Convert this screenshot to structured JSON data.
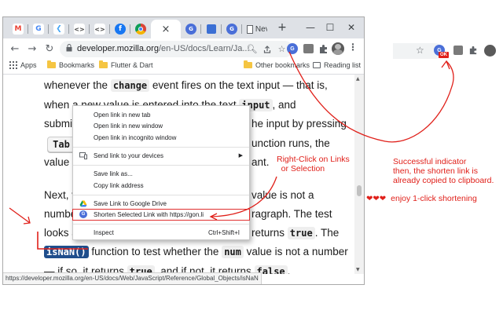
{
  "tabs": [
    {
      "icon": "gmail-icon",
      "letter": "M",
      "color": "#ea4335"
    },
    {
      "icon": "google-icon",
      "letter": "G",
      "color": "#4285f4"
    },
    {
      "icon": "flutter-icon",
      "letter": "❮",
      "color": "#42a5f5"
    },
    {
      "icon": "code-icon",
      "letter": "<>",
      "color": "#555555"
    },
    {
      "icon": "code-icon-2",
      "letter": "<>",
      "color": "#555555"
    },
    {
      "icon": "facebook-icon",
      "letter": "f",
      "color": "#1877f2"
    },
    {
      "icon": "chrome-icon",
      "letter": "",
      "color": "#db4437"
    }
  ],
  "active_tab": {
    "close": "×",
    "title": "Nev"
  },
  "new_tab": "+",
  "window_controls": {
    "minimize": "—",
    "maximize": "☐",
    "close": "✕"
  },
  "toolbar": {
    "back": "←",
    "forward": "→",
    "reload": "↻",
    "url_host": "developer.mozilla.org",
    "url_path": "/en-US/docs/Learn/Ja..."
  },
  "bookmarks": [
    {
      "label": "Apps",
      "kind": "apps"
    },
    {
      "label": "Bookmarks",
      "kind": "folder"
    },
    {
      "label": "Flutter & Dart",
      "kind": "folder"
    },
    {
      "label": "Other bookmarks",
      "kind": "folder"
    },
    {
      "label": "Reading list",
      "kind": "reading"
    }
  ],
  "content": {
    "line1_a": "whenever the ",
    "line1_code": "change",
    "line1_b": " event fires on the text input — that is,",
    "line2_a": "when a new value is entered into the text ",
    "line2_code": "input",
    "line2_b": ", and",
    "line3_a": "submit",
    "line3_b": "he input by pressing",
    "tab_key": "Tab",
    "line4_b": "unction runs, the",
    "line5_a": "value i",
    "line5_b": "ant.",
    "line6_a": "Next, v",
    "line6_b": "value is not a",
    "line7_a": "numbe",
    "line7_b": "ragraph. The test",
    "line8_a": "looks a",
    "line8_b": "returns ",
    "line8_code": "true",
    "line8_c": ". The",
    "line9_code": "isNaN()",
    "line9_b": " function to test whether the ",
    "line9_code2": "num",
    "line9_c": " value is not a number",
    "line10_a": "— if so, it returns ",
    "line10_code": "true",
    "line10_b": ", and if not, it returns ",
    "line10_code2": "false",
    "line10_c": "."
  },
  "status_url": "https://developer.mozilla.org/en-US/docs/Web/JavaScript/Reference/Global_Objects/isNaN",
  "context_menu": {
    "open_new_tab": "Open link in new tab",
    "open_new_window": "Open link in new window",
    "open_incognito": "Open link in incognito window",
    "send_to_devices": "Send link to your devices",
    "save_link_as": "Save link as...",
    "copy_link": "Copy link address",
    "save_to_drive": "Save Link to Google Drive",
    "shorten": "Shorten Selected Link with https://gon.li",
    "inspect": "Inspect",
    "inspect_shortcut": "Ctrl+Shift+I"
  },
  "annotations": {
    "right_click_line1": "Right-Click on Links",
    "right_click_line2": "or Selection",
    "success_1": "Successful indicator",
    "success_2": "then, the shorten link is",
    "success_3": "already copied to clipboard.",
    "enjoy": "enjoy 1-click shortening",
    "hearts": "❤❤❤"
  },
  "badge": "OK",
  "colors": {
    "annotation": "#e0201a",
    "selection": "#1f4e8c",
    "extension": "#4a6fd8"
  }
}
